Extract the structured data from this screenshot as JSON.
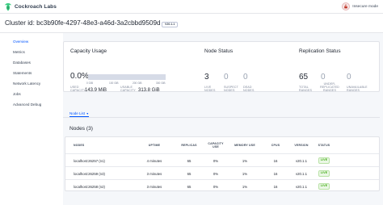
{
  "app": {
    "brand": "Cockroach Labs",
    "insecure_label": "Insecure mode"
  },
  "header": {
    "cluster_title": "Cluster id: bc3b90fe-4297-48e3-a46d-3a2cbbd9509d",
    "version": "V20.1.1"
  },
  "sidebar": {
    "items": [
      {
        "label": "Overview",
        "active": true
      },
      {
        "label": "Metrics"
      },
      {
        "label": "Databases"
      },
      {
        "label": "Statements"
      },
      {
        "label": "Network Latency"
      },
      {
        "label": "Jobs"
      },
      {
        "label": "Advanced Debug"
      }
    ]
  },
  "capacity": {
    "title": "Capacity Usage",
    "percent": "0.0%",
    "usage_fraction": 0.0,
    "ticks": [
      "0 GiB",
      "100 GiB",
      "200 GiB",
      "300 GiB"
    ],
    "used_label": "USED CAPACITY",
    "used_value": "143.9 MiB",
    "usable_label": "USABLE CAPACITY",
    "usable_value": "313.8 GiB"
  },
  "node_status": {
    "title": "Node Status",
    "stats": [
      {
        "value": "3",
        "label": "LIVE NODES",
        "muted": false
      },
      {
        "value": "0",
        "label": "SUSPECT NODES",
        "muted": true
      },
      {
        "value": "0",
        "label": "DEAD NODES",
        "muted": true
      }
    ]
  },
  "replication": {
    "title": "Replication Status",
    "stats": [
      {
        "value": "65",
        "label": "TOTAL RANGES",
        "muted": false
      },
      {
        "value": "0",
        "label": "UNDER-REPLICATED RANGES",
        "muted": true
      },
      {
        "value": "0",
        "label": "UNAVAILABLE RANGES",
        "muted": true
      }
    ]
  },
  "tabs": {
    "node_list": "Node List",
    "node_list_caret": "▾"
  },
  "nodes": {
    "title": "Nodes (3)",
    "columns": [
      "NODES",
      "UPTIME",
      "REPLICAS",
      "CAPACITY USE",
      "MEMORY USE",
      "CPUS",
      "VERSION",
      "STATUS"
    ],
    "rows": [
      {
        "name": "localhost:26257 (n1)",
        "uptime": "4 minutes",
        "replicas": "65",
        "capacity": "0%",
        "memory": "1%",
        "cpus": "16",
        "version": "v20.1.1",
        "status": "LIVE"
      },
      {
        "name": "localhost:26259 (n3)",
        "uptime": "3 minutes",
        "replicas": "65",
        "capacity": "0%",
        "memory": "1%",
        "cpus": "16",
        "version": "v20.1.1",
        "status": "LIVE"
      },
      {
        "name": "localhost:26258 (n2)",
        "uptime": "3 minutes",
        "replicas": "65",
        "capacity": "0%",
        "memory": "1%",
        "cpus": "16",
        "version": "v20.1.1",
        "status": "LIVE"
      }
    ]
  },
  "colors": {
    "accent": "#0055ff",
    "live": "#37a806",
    "bar": "#d6dbe7"
  }
}
